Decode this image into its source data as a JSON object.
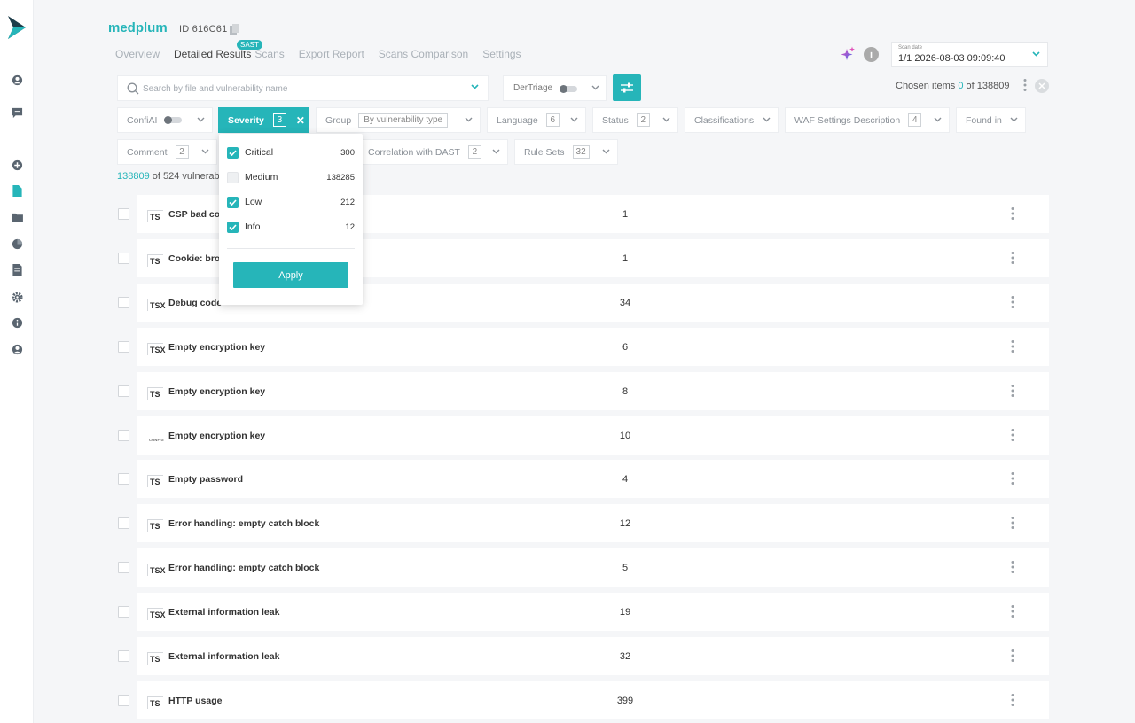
{
  "app": {
    "title": "medplum",
    "id_label": "ID 616C61"
  },
  "tabs": [
    {
      "label": "Overview",
      "active": false
    },
    {
      "label": "Detailed Results",
      "active": true
    },
    {
      "label": "Scans",
      "active": false
    },
    {
      "label": "Export Report",
      "active": false
    },
    {
      "label": "Scans Comparison",
      "active": false
    },
    {
      "label": "Settings",
      "active": false
    }
  ],
  "sast_badge": "SAST",
  "scan_date": {
    "label": "Scan date",
    "value": "1/1 2026-08-03 09:09:40"
  },
  "search": {
    "placeholder": "Search by file and vulnerability name",
    "value": ""
  },
  "dertriage": {
    "label": "DerTriage",
    "enabled": false
  },
  "chosen": {
    "prefix": "Chosen items",
    "count": "0",
    "of": "of",
    "total": "138809"
  },
  "filters": {
    "confiai": "ConfiAI",
    "severity": {
      "label": "Severity",
      "count": "3"
    },
    "group": {
      "label": "Group",
      "value": "By vulnerability type"
    },
    "language": {
      "label": "Language",
      "count": "6"
    },
    "status": {
      "label": "Status",
      "count": "2"
    },
    "classifications": "Classifications",
    "waf": {
      "label": "WAF Settings Description",
      "count": "4"
    },
    "found_in": "Found in",
    "comment": {
      "label": "Comment",
      "count": "2"
    },
    "correlation": {
      "label": "Correlation with DAST",
      "count": "2"
    },
    "rule_sets": {
      "label": "Rule Sets",
      "count": "32"
    }
  },
  "results": {
    "shown": "138809",
    "text": "of  524 vulnerab"
  },
  "severity_dropdown": {
    "options": [
      {
        "label": "Critical",
        "count": "300",
        "checked": true
      },
      {
        "label": "Medium",
        "count": "138285",
        "checked": false
      },
      {
        "label": "Low",
        "count": "212",
        "checked": true
      },
      {
        "label": "Info",
        "count": "12",
        "checked": true
      }
    ],
    "apply_label": "Apply"
  },
  "rows": [
    {
      "type": "TS",
      "name": "CSP bad co",
      "count": "1"
    },
    {
      "type": "TS",
      "name": "Cookie: bro",
      "count": "1"
    },
    {
      "type": "TSX",
      "name": "Debug code",
      "count": "34"
    },
    {
      "type": "TSX",
      "name": "Empty encryption key",
      "count": "6"
    },
    {
      "type": "TS",
      "name": "Empty encryption key",
      "count": "8"
    },
    {
      "type": "CONFIG",
      "name": "Empty encryption key",
      "count": "10"
    },
    {
      "type": "TS",
      "name": "Empty password",
      "count": "4"
    },
    {
      "type": "TS",
      "name": "Error handling: empty catch block",
      "count": "12"
    },
    {
      "type": "TSX",
      "name": "Error handling: empty catch block",
      "count": "5"
    },
    {
      "type": "TSX",
      "name": "External information leak",
      "count": "19"
    },
    {
      "type": "TS",
      "name": "External information leak",
      "count": "32"
    },
    {
      "type": "TS",
      "name": "HTTP usage",
      "count": "399"
    }
  ],
  "colors": {
    "accent": "#26b5b9",
    "background": "#f5f6f8"
  }
}
